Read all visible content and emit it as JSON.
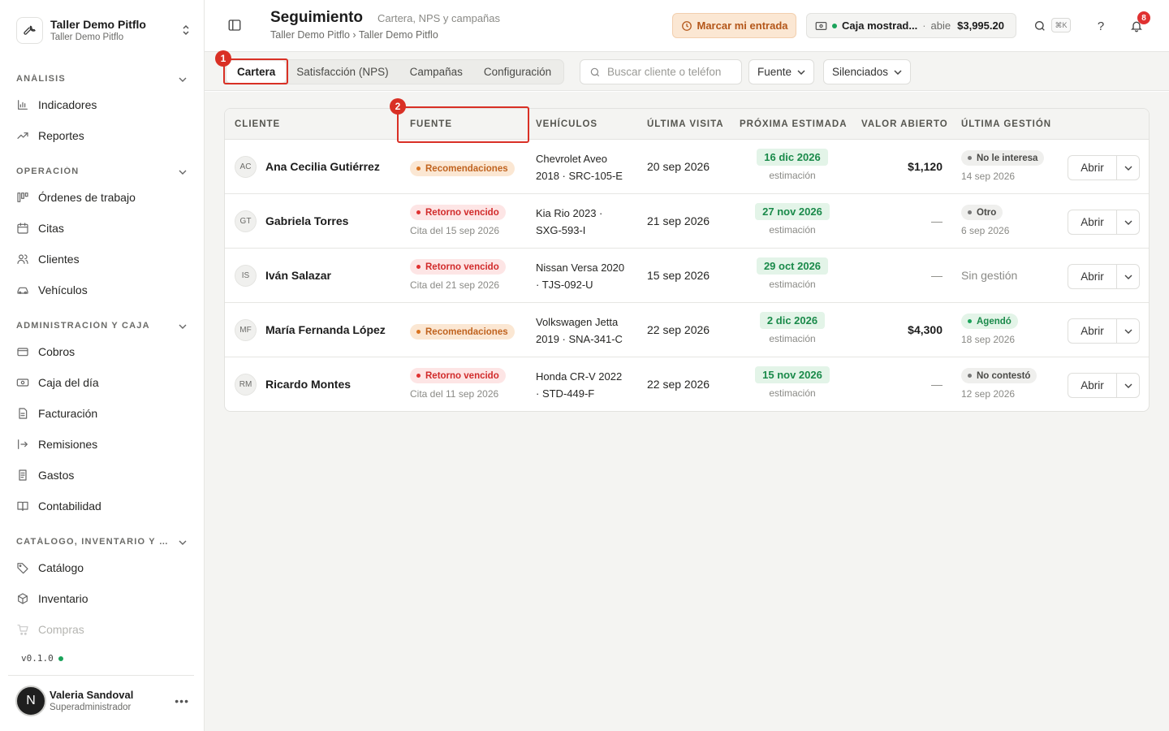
{
  "org": {
    "name": "Taller Demo Pitflo",
    "subtitle": "Taller Demo Pitflo"
  },
  "sidebar": {
    "sections": [
      {
        "title": "ANÁLISIS",
        "items": [
          {
            "label": "Indicadores",
            "icon": "bar-chart-icon"
          },
          {
            "label": "Reportes",
            "icon": "trend-icon"
          }
        ]
      },
      {
        "title": "OPERACIÓN",
        "items": [
          {
            "label": "Órdenes de trabajo",
            "icon": "kanban-icon"
          },
          {
            "label": "Citas",
            "icon": "calendar-icon"
          },
          {
            "label": "Clientes",
            "icon": "users-icon"
          },
          {
            "label": "Vehículos",
            "icon": "car-icon"
          }
        ]
      },
      {
        "title": "ADMINISTRACIÓN Y CAJA",
        "items": [
          {
            "label": "Cobros",
            "icon": "card-icon"
          },
          {
            "label": "Caja del día",
            "icon": "cash-icon"
          },
          {
            "label": "Facturación",
            "icon": "document-icon"
          },
          {
            "label": "Remisiones",
            "icon": "export-icon"
          },
          {
            "label": "Gastos",
            "icon": "receipt-icon"
          },
          {
            "label": "Contabilidad",
            "icon": "book-icon"
          }
        ]
      },
      {
        "title": "CATÁLOGO, INVENTARIO Y CO...",
        "items": [
          {
            "label": "Catálogo",
            "icon": "tag-icon"
          },
          {
            "label": "Inventario",
            "icon": "box-icon"
          },
          {
            "label": "Compras",
            "icon": "cart-icon"
          }
        ]
      }
    ],
    "version": "v0.1.0"
  },
  "user": {
    "initial": "N",
    "name": "Valeria Sandoval",
    "role": "Superadministrador"
  },
  "header": {
    "title": "Seguimiento",
    "subtitle": "Cartera, NPS y campañas",
    "breadcrumb": "Taller Demo Pitflo › Taller Demo Pitflo",
    "entry_button": "Marcar mi entrada",
    "cash": {
      "name": "Caja mostrad...",
      "separator": "·",
      "status": "abie",
      "amount": "$3,995.20"
    },
    "shortcut": "⌘K",
    "notifications": "8"
  },
  "tabs": [
    "Cartera",
    "Satisfacción (NPS)",
    "Campañas",
    "Configuración"
  ],
  "search": {
    "placeholder": "Buscar cliente o teléfon"
  },
  "filters": {
    "source": "Fuente",
    "muted": "Silenciados"
  },
  "annotations": [
    "1",
    "2"
  ],
  "table": {
    "headers": [
      "CLIENTE",
      "FUENTE",
      "VEHÍCULOS",
      "ÚLTIMA VISITA",
      "PRÓXIMA ESTIMADA",
      "VALOR ABIERTO",
      "ÚLTIMA GESTIÓN"
    ],
    "open_label": "Abrir",
    "rows": [
      {
        "initials": "AC",
        "name": "Ana Cecilia Gutiérrez",
        "source": "Recomendaciones",
        "source_style": "orange",
        "source_sub": "",
        "vehicle_1": "Chevrolet Aveo",
        "vehicle_2": "2018 · SRC-105-E",
        "last_visit": "20 sep 2026",
        "next_date": "16 dic 2026",
        "next_sub": "estimación",
        "open_value": "$1,120",
        "mgmt": "No le interesa",
        "mgmt_style": "gray",
        "mgmt_date": "14 sep 2026"
      },
      {
        "initials": "GT",
        "name": "Gabriela Torres",
        "source": "Retorno vencido",
        "source_style": "red",
        "source_sub": "Cita del 15 sep 2026",
        "vehicle_1": "Kia Rio 2023 ·",
        "vehicle_2": "SXG-593-I",
        "last_visit": "21 sep 2026",
        "next_date": "27 nov 2026",
        "next_sub": "estimación",
        "open_value": "—",
        "mgmt": "Otro",
        "mgmt_style": "gray",
        "mgmt_date": "6 sep 2026"
      },
      {
        "initials": "IS",
        "name": "Iván Salazar",
        "source": "Retorno vencido",
        "source_style": "red",
        "source_sub": "Cita del 21 sep 2026",
        "vehicle_1": "Nissan Versa 2020",
        "vehicle_2": "· TJS-092-U",
        "last_visit": "15 sep 2026",
        "next_date": "29 oct 2026",
        "next_sub": "estimación",
        "open_value": "—",
        "mgmt": "",
        "mgmt_style": "none",
        "mgmt_date": "",
        "mgmt_none": "Sin gestión"
      },
      {
        "initials": "MF",
        "name": "María Fernanda López",
        "source": "Recomendaciones",
        "source_style": "orange",
        "source_sub": "",
        "vehicle_1": "Volkswagen Jetta",
        "vehicle_2": "2019 · SNA-341-C",
        "last_visit": "22 sep 2026",
        "next_date": "2 dic 2026",
        "next_sub": "estimación",
        "open_value": "$4,300",
        "mgmt": "Agendó",
        "mgmt_style": "green",
        "mgmt_date": "18 sep 2026"
      },
      {
        "initials": "RM",
        "name": "Ricardo Montes",
        "source": "Retorno vencido",
        "source_style": "red",
        "source_sub": "Cita del 11 sep 2026",
        "vehicle_1": "Honda CR-V 2022",
        "vehicle_2": "· STD-449-F",
        "last_visit": "22 sep 2026",
        "next_date": "15 nov 2026",
        "next_sub": "estimación",
        "open_value": "—",
        "mgmt": "No contestó",
        "mgmt_style": "gray",
        "mgmt_date": "12 sep 2026"
      }
    ]
  },
  "colors": {
    "accent_orange": "#c0631f",
    "danger": "#d12b2b",
    "success": "#1a8a4a",
    "annotation": "#d93025"
  }
}
